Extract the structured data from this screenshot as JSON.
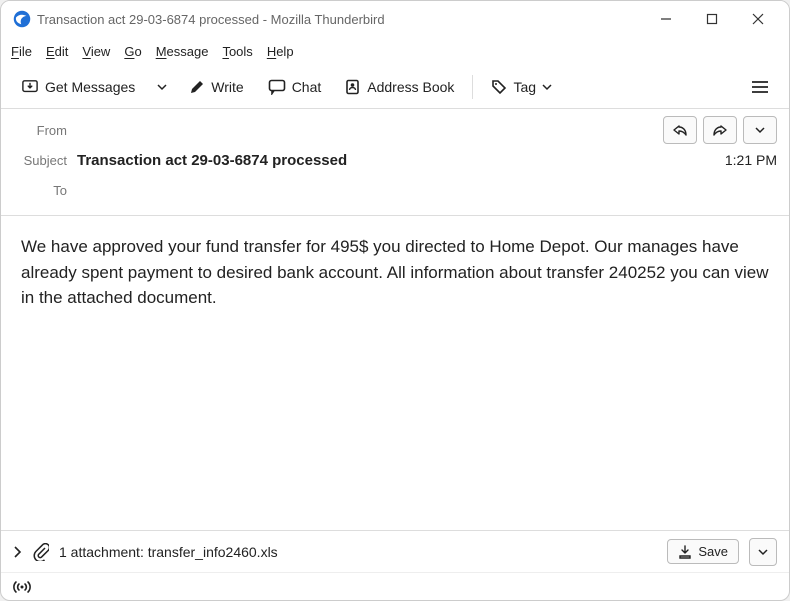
{
  "window": {
    "title": "Transaction act 29-03-6874 processed - Mozilla Thunderbird"
  },
  "menubar": {
    "file": "File",
    "edit": "Edit",
    "view": "View",
    "go": "Go",
    "message": "Message",
    "tools": "Tools",
    "help": "Help"
  },
  "toolbar": {
    "get_messages": "Get Messages",
    "write": "Write",
    "chat": "Chat",
    "address_book": "Address Book",
    "tag": "Tag"
  },
  "headers": {
    "from_label": "From",
    "from_value": "",
    "subject_label": "Subject",
    "subject_value": "Transaction act 29-03-6874 processed",
    "to_label": "To",
    "to_value": "",
    "time": "1:21 PM"
  },
  "body": {
    "text": "We have approved your fund transfer for 495$ you directed to Home Depot. Our manages have already spent payment to desired bank account. All information about transfer 240252 you can view in the attached document."
  },
  "attachment": {
    "summary": "1 attachment: transfer_info2460.xls",
    "save_label": "Save"
  }
}
